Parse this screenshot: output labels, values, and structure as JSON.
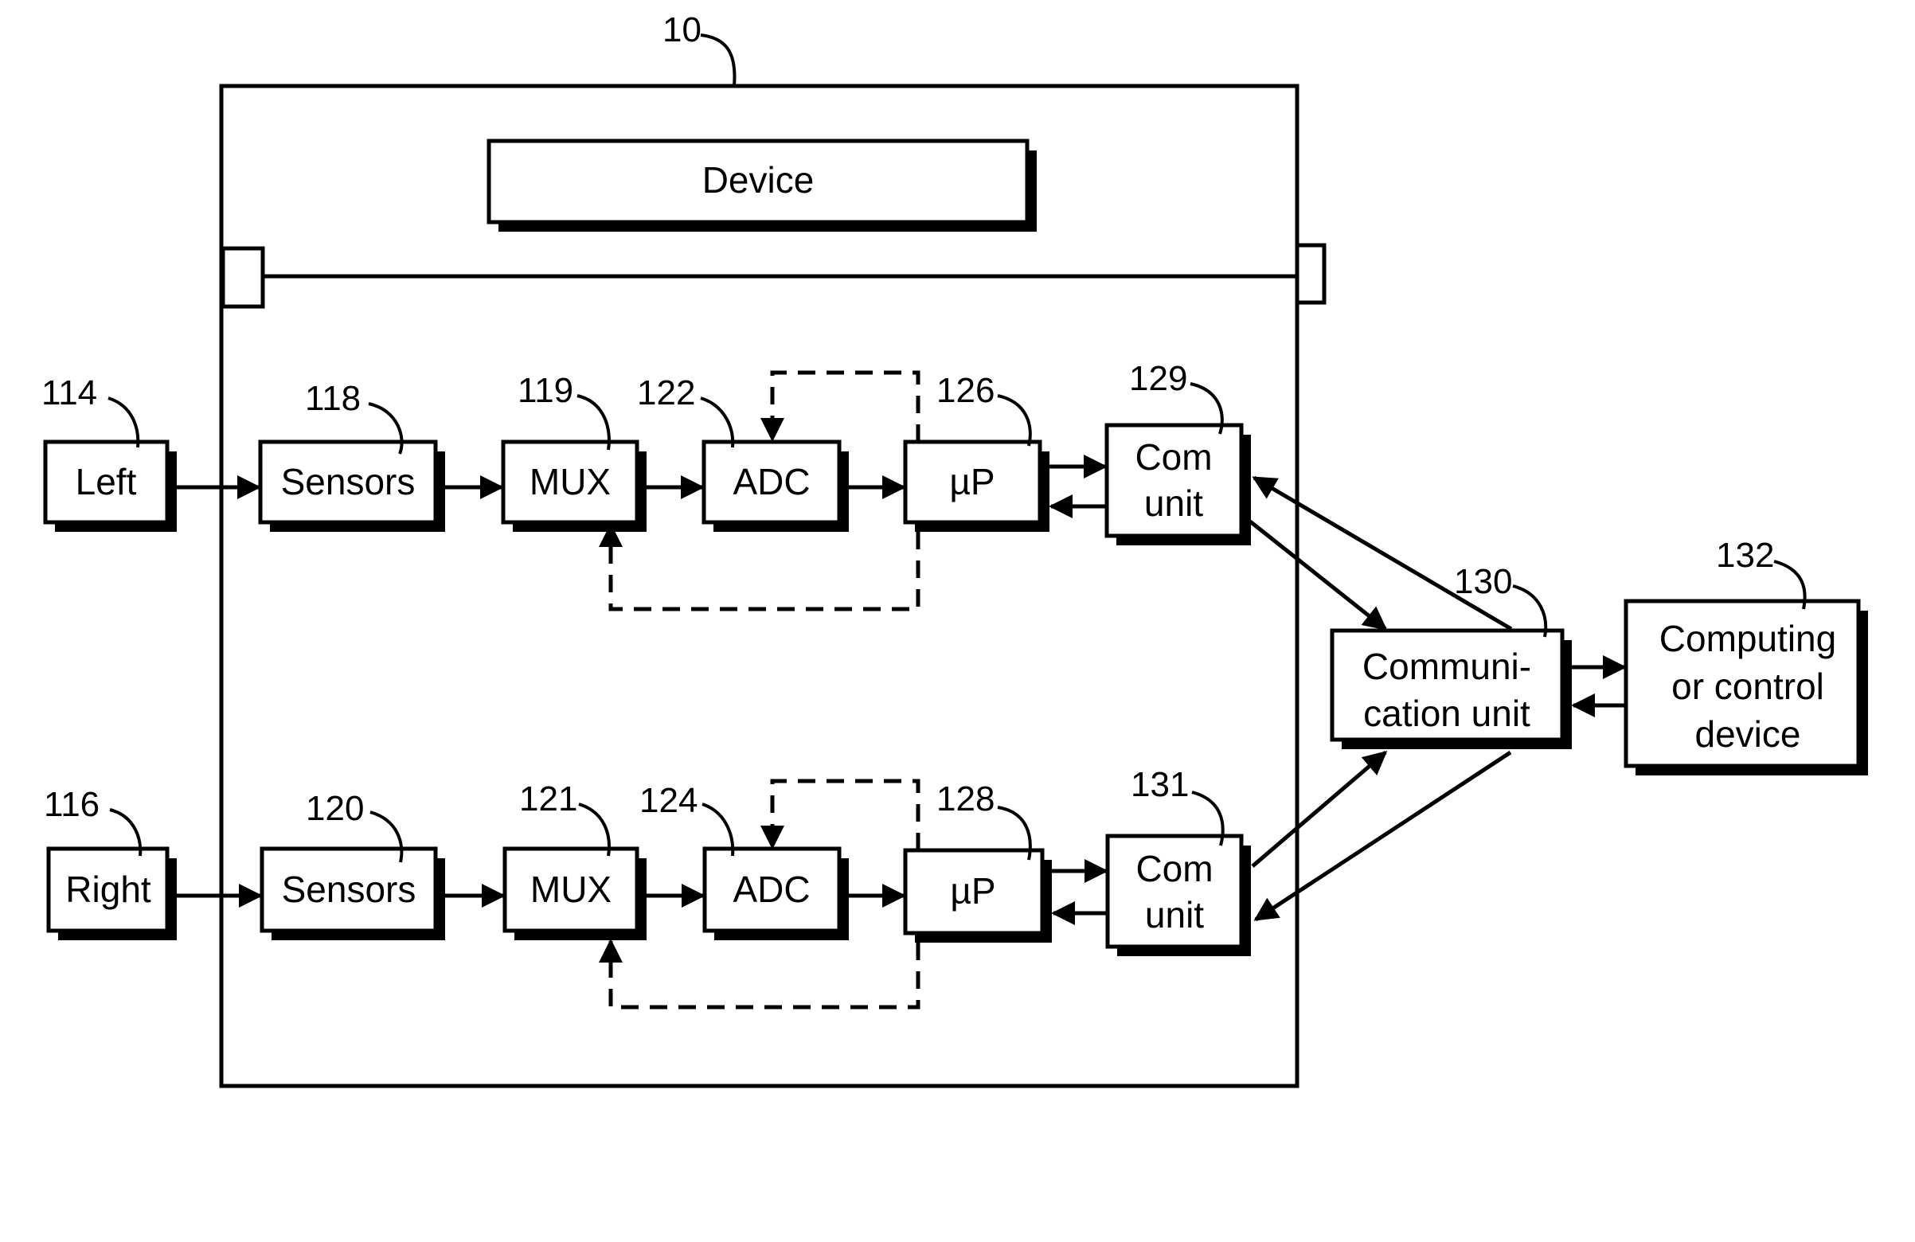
{
  "diagram": {
    "device_ref": "10",
    "device_label": "Device",
    "rows": [
      {
        "side": {
          "ref": "114",
          "label": "Left"
        },
        "sensors": {
          "ref": "118",
          "label": "Sensors"
        },
        "mux": {
          "ref": "119",
          "label": "MUX"
        },
        "adc": {
          "ref": "122",
          "label": "ADC"
        },
        "up": {
          "ref": "126",
          "label": "µP"
        },
        "com": {
          "ref": "129",
          "line1": "Com",
          "line2": "unit"
        }
      },
      {
        "side": {
          "ref": "116",
          "label": "Right"
        },
        "sensors": {
          "ref": "120",
          "label": "Sensors"
        },
        "mux": {
          "ref": "121",
          "label": "MUX"
        },
        "adc": {
          "ref": "124",
          "label": "ADC"
        },
        "up": {
          "ref": "128",
          "label": "µP"
        },
        "com": {
          "ref": "131",
          "line1": "Com",
          "line2": "unit"
        }
      }
    ],
    "comm_unit": {
      "ref": "130",
      "line1": "Communi-",
      "line2": "cation unit"
    },
    "computing": {
      "ref": "132",
      "line1": "Computing",
      "line2": "or control",
      "line3": "device"
    }
  }
}
